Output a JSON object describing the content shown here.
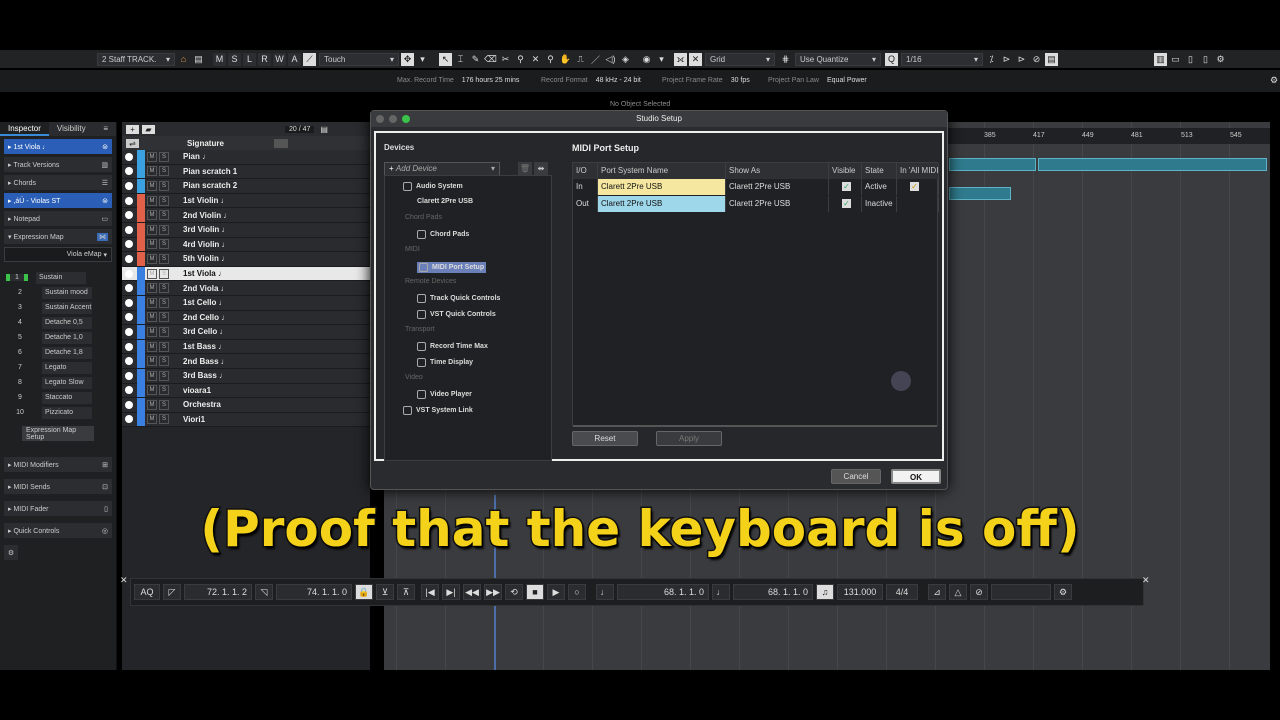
{
  "toolbar": {
    "track_select": "2 Staff TRACK.",
    "mode_letters": [
      "M",
      "S",
      "L",
      "R",
      "W",
      "A"
    ],
    "automation_mode": "Touch",
    "snap_type": "Grid",
    "quantize_mode": "Use Quantize",
    "quantize_value": "1/16"
  },
  "infobar": {
    "no_object": "No Object Selected",
    "max_record_label": "Max. Record Time",
    "max_record_value": "176 hours 25 mins",
    "record_format_label": "Record Format",
    "record_format_value": "48 kHz - 24 bit",
    "frame_rate_label": "Project Frame Rate",
    "frame_rate_value": "30 fps",
    "pan_law_label": "Project Pan Law",
    "pan_law_value": "Equal Power"
  },
  "inspector": {
    "tabs": [
      "Inspector",
      "Visibility"
    ],
    "track_name": "1st Viola ♩",
    "sections": [
      "Track Versions",
      "Chords"
    ],
    "viola_st": ",áÜ - Violas ST",
    "notepad": "Notepad",
    "expression_map": "Expression Map",
    "emap_name": "Viola eMap",
    "articulations": [
      {
        "n": "1",
        "v": "Sustain"
      },
      {
        "n": "2",
        "v": "Sustain mood"
      },
      {
        "n": "3",
        "v": "Sustain Accent"
      },
      {
        "n": "4",
        "v": "Detache 0,5"
      },
      {
        "n": "5",
        "v": "Detache 1,0"
      },
      {
        "n": "6",
        "v": "Detache 1,8"
      },
      {
        "n": "7",
        "v": "Legato"
      },
      {
        "n": "8",
        "v": "Legato Slow"
      },
      {
        "n": "9",
        "v": "Staccato"
      },
      {
        "n": "10",
        "v": "Pizzicato"
      }
    ],
    "setup_button": "Expression Map Setup",
    "bottom_sections": [
      "MIDI Modifiers",
      "MIDI Sends",
      "MIDI Fader",
      "Quick Controls"
    ]
  },
  "tracklist": {
    "counter": "20 / 47",
    "column": "Signature",
    "tracks": [
      "Pian ♩",
      "Pian scratch 1",
      "Pian scratch 2",
      "1st Violin ♩",
      "2nd Violin ♩",
      "3rd Violin ♩",
      "4rd Violin ♩",
      "5th Violin ♩",
      "1st Viola ♩",
      "2nd Viola ♩",
      "1st Cello ♩",
      "2nd Cello ♩",
      "3rd  Cello ♩",
      "1st Bass ♩",
      "2nd Bass ♩",
      "3rd Bass ♩",
      "vioara1",
      "Orchestra",
      "Viori1"
    ],
    "track_colors": [
      "#3aa0e0",
      "#3aa0e0",
      "#3aa0e0",
      "#e0604a",
      "#e0604a",
      "#e0604a",
      "#e0604a",
      "#e0604a",
      "#3a80e0",
      "#3a80e0",
      "#3a80e0",
      "#3a80e0",
      "#3a80e0",
      "#3a80e0",
      "#3a80e0",
      "#3a80e0",
      "#3a80e0",
      "#3a80e0",
      "#3a80e0"
    ]
  },
  "ruler": [
    "385",
    "417",
    "449",
    "481",
    "513",
    "545"
  ],
  "dialog": {
    "title": "Studio Setup",
    "devices_title": "Devices",
    "add_device": "Add Device",
    "device_tree": [
      {
        "type": "item",
        "label": "Audio System",
        "top": 0
      },
      {
        "type": "item",
        "label": "Clarett 2Pre USB",
        "top": 1
      },
      {
        "type": "cat",
        "label": "Chord Pads"
      },
      {
        "type": "item",
        "label": "Chord Pads"
      },
      {
        "type": "cat",
        "label": "MIDI"
      },
      {
        "type": "item",
        "label": "MIDI Port Setup"
      },
      {
        "type": "cat",
        "label": "Remote Devices"
      },
      {
        "type": "item",
        "label": "Track Quick Controls"
      },
      {
        "type": "item",
        "label": "VST Quick Controls"
      },
      {
        "type": "cat",
        "label": "Transport"
      },
      {
        "type": "item",
        "label": "Record Time Max"
      },
      {
        "type": "item",
        "label": "Time Display"
      },
      {
        "type": "cat",
        "label": "Video"
      },
      {
        "type": "item",
        "label": "Video Player"
      },
      {
        "type": "item",
        "label": "VST System Link"
      }
    ],
    "panel_title": "MIDI Port Setup",
    "columns": [
      "I/O",
      "Port System Name",
      "Show As",
      "Visible",
      "State",
      "In 'All MIDI"
    ],
    "rows": [
      {
        "io": "In",
        "port": "Clarett 2Pre USB",
        "show_as": "Clarett 2Pre USB",
        "visible": "✓",
        "state": "Active",
        "all_midi": "✓"
      },
      {
        "io": "Out",
        "port": "Clarett 2Pre USB",
        "show_as": "Clarett 2Pre USB",
        "visible": "✓",
        "state": "Inactive",
        "all_midi": ""
      }
    ],
    "reset": "Reset",
    "apply": "Apply",
    "cancel": "Cancel",
    "ok": "OK"
  },
  "transport": {
    "aq": "AQ",
    "left_locator": "72. 1. 1.  2",
    "right_locator": "74. 1. 1.  0",
    "primary_time": "68. 1. 1.  0",
    "secondary_time": "68. 1. 1.  0",
    "tempo": "131.000",
    "signature": "4/4"
  },
  "caption": "(Proof that the keyboard is off)"
}
